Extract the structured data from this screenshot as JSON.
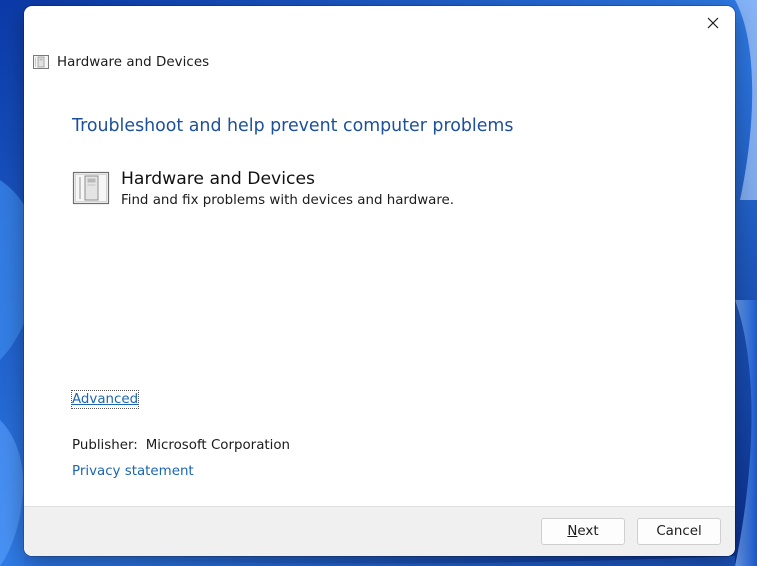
{
  "window": {
    "title": "Hardware and Devices",
    "close_glyph": "close-icon"
  },
  "main": {
    "heading": "Troubleshoot and help prevent computer problems",
    "item": {
      "icon": "hardware-device-icon",
      "title": "Hardware and Devices",
      "description": "Find and fix problems with devices and hardware."
    },
    "advanced_link": "Advanced",
    "publisher_label": "Publisher:",
    "publisher_value": "Microsoft Corporation",
    "privacy_link": "Privacy statement"
  },
  "footer": {
    "next_accel": "N",
    "next_rest": "ext",
    "cancel_label": "Cancel"
  },
  "colors": {
    "heading": "#1d4f9c",
    "link": "#1a66b3",
    "footer_bg": "#f0f0f0",
    "wallpaper": "#1a56c9"
  }
}
